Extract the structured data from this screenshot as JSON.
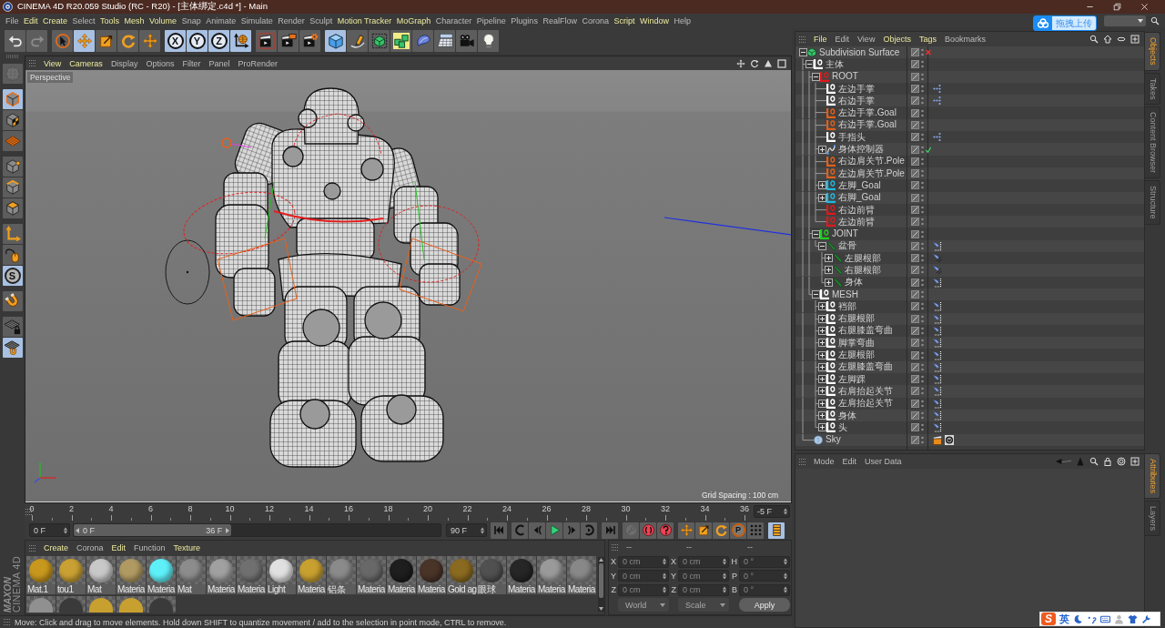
{
  "window": {
    "title": "CINEMA 4D R20.059 Studio (RC - R20) - [主体绑定.c4d *] - Main"
  },
  "menu_bar": [
    {
      "label": "File",
      "highlighted": false
    },
    {
      "label": "Edit",
      "highlighted": true
    },
    {
      "label": "Create",
      "highlighted": true
    },
    {
      "label": "Select",
      "highlighted": false
    },
    {
      "label": "Tools",
      "highlighted": true
    },
    {
      "label": "Mesh",
      "highlighted": true
    },
    {
      "label": "Volume",
      "highlighted": true
    },
    {
      "label": "Snap",
      "highlighted": false
    },
    {
      "label": "Animate",
      "highlighted": false
    },
    {
      "label": "Simulate",
      "highlighted": false
    },
    {
      "label": "Render",
      "highlighted": false
    },
    {
      "label": "Sculpt",
      "highlighted": false
    },
    {
      "label": "Motion Tracker",
      "highlighted": true
    },
    {
      "label": "MoGraph",
      "highlighted": true
    },
    {
      "label": "Character",
      "highlighted": false
    },
    {
      "label": "Pipeline",
      "highlighted": false
    },
    {
      "label": "Plugins",
      "highlighted": false
    },
    {
      "label": "RealFlow",
      "highlighted": false
    },
    {
      "label": "Corona",
      "highlighted": false
    },
    {
      "label": "Script",
      "highlighted": true
    },
    {
      "label": "Window",
      "highlighted": true
    },
    {
      "label": "Help",
      "highlighted": false
    }
  ],
  "upload_widget": {
    "label": "拖拽上传"
  },
  "toolbar": [
    {
      "tools": [
        {
          "kind": "undo",
          "on": false,
          "disabled": false
        },
        {
          "kind": "redo",
          "on": false,
          "disabled": true
        }
      ]
    },
    {
      "tools": [
        {
          "kind": "live-select",
          "on": false,
          "disabled": false
        },
        {
          "kind": "move",
          "on": true,
          "disabled": false
        },
        {
          "kind": "scale",
          "on": false,
          "disabled": false
        },
        {
          "kind": "rotate",
          "on": false,
          "disabled": false
        },
        {
          "kind": "recent-tool",
          "on": false,
          "disabled": false
        }
      ]
    },
    {
      "tools": [
        {
          "kind": "axis-x",
          "label": "X",
          "on": true,
          "disabled": false
        },
        {
          "kind": "axis-y",
          "label": "Y",
          "on": true,
          "disabled": false
        },
        {
          "kind": "axis-z",
          "label": "Z",
          "on": true,
          "disabled": false
        },
        {
          "kind": "coordinate-system",
          "on": true,
          "disabled": false
        }
      ]
    },
    {
      "tools": [
        {
          "kind": "render-view",
          "on": false,
          "disabled": false
        },
        {
          "kind": "render-to-viewer",
          "on": false,
          "disabled": false
        },
        {
          "kind": "render-settings",
          "on": false,
          "disabled": false
        }
      ]
    },
    {
      "tools": [
        {
          "kind": "cube",
          "on": true,
          "disabled": false
        },
        {
          "kind": "pen",
          "on": false,
          "disabled": false
        },
        {
          "kind": "subdivision",
          "on": false,
          "disabled": false
        },
        {
          "kind": "array",
          "on": false,
          "disabled": false
        },
        {
          "kind": "deformer",
          "on": false,
          "disabled": false
        },
        {
          "kind": "floor",
          "on": false,
          "disabled": false
        },
        {
          "kind": "camera",
          "on": false,
          "disabled": false
        },
        {
          "kind": "light",
          "on": false,
          "disabled": false
        }
      ]
    }
  ],
  "tool_palette": [
    {
      "tools": [
        {
          "kind": "make-editable",
          "on": false,
          "disabled": true
        }
      ]
    },
    {
      "tools": [
        {
          "kind": "model-mode",
          "on": true,
          "disabled": false
        },
        {
          "kind": "texture-mode",
          "on": false,
          "disabled": false
        },
        {
          "kind": "workplane-mode",
          "on": false,
          "disabled": false
        }
      ]
    },
    {
      "tools": [
        {
          "kind": "points-mode",
          "on": false,
          "disabled": false
        },
        {
          "kind": "edges-mode",
          "on": false,
          "disabled": false
        },
        {
          "kind": "polygons-mode",
          "on": false,
          "disabled": false
        }
      ]
    },
    {
      "tools": [
        {
          "kind": "axis-mode",
          "on": false,
          "disabled": false
        },
        {
          "kind": "tweak-mode",
          "on": false,
          "disabled": false
        },
        {
          "kind": "solo",
          "label": "S",
          "on": true,
          "disabled": false
        }
      ]
    },
    {
      "tools": [
        {
          "kind": "snap",
          "on": false,
          "disabled": false
        }
      ]
    },
    {
      "tools": [
        {
          "kind": "workplane-lock",
          "on": false,
          "disabled": false
        },
        {
          "kind": "planar-snap",
          "on": true,
          "disabled": false
        }
      ]
    }
  ],
  "viewport": {
    "menu": [
      {
        "label": "View",
        "highlighted": true
      },
      {
        "label": "Cameras",
        "highlighted": true
      },
      {
        "label": "Display",
        "highlighted": false
      },
      {
        "label": "Options",
        "highlighted": false
      },
      {
        "label": "Filter",
        "highlighted": false
      },
      {
        "label": "Panel",
        "highlighted": false
      },
      {
        "label": "ProRender",
        "highlighted": false
      }
    ],
    "camera": "Perspective",
    "grid_spacing": "Grid Spacing : 100 cm"
  },
  "timeline": {
    "ticks": [
      "0",
      "2",
      "4",
      "6",
      "8",
      "10",
      "12",
      "14",
      "16",
      "18",
      "20",
      "22",
      "24",
      "26",
      "28",
      "30",
      "32",
      "34",
      "36"
    ],
    "frame_field": "-5 F"
  },
  "transport": {
    "start_field": "0 F",
    "range": {
      "start": "0 F",
      "end": "36 F",
      "level": 0.43
    },
    "end_field": "90 F",
    "groups": [
      {
        "tools": [
          {
            "kind": "go-start",
            "on": false,
            "disabled": false
          }
        ]
      },
      {
        "tools": [
          {
            "kind": "prev-key",
            "on": false,
            "disabled": false
          },
          {
            "kind": "prev-frame",
            "on": false,
            "disabled": false
          },
          {
            "kind": "play",
            "on": false,
            "disabled": false
          },
          {
            "kind": "next-frame",
            "on": false,
            "disabled": false
          },
          {
            "kind": "next-key",
            "on": false,
            "disabled": false
          }
        ]
      },
      {
        "tools": [
          {
            "kind": "go-end",
            "on": false,
            "disabled": false
          }
        ]
      },
      {
        "tools": [
          {
            "kind": "keyframe",
            "on": false,
            "disabled": true
          },
          {
            "kind": "record",
            "on": false,
            "disabled": false
          },
          {
            "kind": "autokey",
            "on": false,
            "disabled": false
          }
        ]
      },
      {
        "tools": [
          {
            "kind": "key-position",
            "on": false,
            "disabled": false
          },
          {
            "kind": "key-scale",
            "on": false,
            "disabled": false
          },
          {
            "kind": "key-rotation",
            "on": false,
            "disabled": false
          },
          {
            "kind": "key-param",
            "label": "P",
            "on": false,
            "disabled": false
          },
          {
            "kind": "key-pla",
            "on": false,
            "disabled": false
          }
        ]
      },
      {
        "tools": [
          {
            "kind": "timeline",
            "on": true,
            "disabled": false
          }
        ]
      }
    ]
  },
  "materials": {
    "menu": [
      {
        "label": "Create",
        "highlighted": true
      },
      {
        "label": "Corona",
        "highlighted": false
      },
      {
        "label": "Edit",
        "highlighted": true
      },
      {
        "label": "Function",
        "highlighted": false
      },
      {
        "label": "Texture",
        "highlighted": true
      }
    ],
    "items": [
      {
        "label": "Mat.1",
        "color": "#c8971e"
      },
      {
        "label": "tou1",
        "color": "#c9a033"
      },
      {
        "label": "Mat",
        "color": "#c8c8c8"
      },
      {
        "label": "Materia",
        "color": "#b09a62"
      },
      {
        "label": "Materia",
        "color": "#5ef0f8"
      },
      {
        "label": "Mat",
        "color": "#8c8c8c"
      },
      {
        "label": "Materia",
        "color": "#a0a0a0"
      },
      {
        "label": "Materia",
        "color": "#707070"
      },
      {
        "label": "Light",
        "color": "#e0e0e0"
      },
      {
        "label": "Materia",
        "color": "#c8a030"
      },
      {
        "label": "铝条",
        "color": "#8a8a8a"
      },
      {
        "label": "Materia",
        "color": "#686868"
      },
      {
        "label": "Materia",
        "color": "#1e1e1e"
      },
      {
        "label": "Materia",
        "color": "#4a3428"
      },
      {
        "label": "Gold ag",
        "color": "#8a6a20"
      },
      {
        "label": "眼球",
        "color": "#505050"
      },
      {
        "label": "Materia",
        "color": "#262626"
      },
      {
        "label": "Materia",
        "color": "#9a9a9a"
      },
      {
        "label": "Materia",
        "color": "#888888"
      },
      {
        "color": "#909090"
      },
      {
        "color": "#3a3a3a"
      },
      {
        "color": "#c8a030"
      },
      {
        "color": "#c8a030"
      },
      {
        "color": "#3a3a3a"
      }
    ]
  },
  "coordinates": {
    "headers": [
      "--",
      "--",
      "--"
    ],
    "columns": [
      {
        "fields": [
          {
            "label": "X",
            "value": "0 cm",
            "disabled": true
          },
          {
            "label": "Y",
            "value": "0 cm",
            "disabled": true
          },
          {
            "label": "Z",
            "value": "0 cm",
            "disabled": true
          }
        ]
      },
      {
        "fields": [
          {
            "label": "X",
            "value": "0 cm",
            "disabled": true
          },
          {
            "label": "Y",
            "value": "0 cm",
            "disabled": true
          },
          {
            "label": "Z",
            "value": "0 cm",
            "disabled": true
          }
        ]
      },
      {
        "fields": [
          {
            "label": "H",
            "value": "0 °",
            "disabled": true
          },
          {
            "label": "P",
            "value": "0 °",
            "disabled": true
          },
          {
            "label": "B",
            "value": "0 °",
            "disabled": true
          }
        ]
      }
    ],
    "dropdowns": [
      {
        "value": "World",
        "disabled": true
      },
      {
        "value": "Scale",
        "disabled": true
      }
    ],
    "apply": {
      "label": "Apply",
      "disabled": false
    }
  },
  "logo": {
    "brand": "MAXON",
    "product": "CINEMA 4D"
  },
  "status_bar": {
    "text": "Move: Click and drag to move elements. Hold down SHIFT to quantize movement / add to the selection in point mode, CTRL to remove."
  },
  "object_manager": {
    "menu": [
      {
        "label": "File",
        "highlighted": true
      },
      {
        "label": "Edit",
        "highlighted": false
      },
      {
        "label": "View",
        "highlighted": false
      },
      {
        "label": "Objects",
        "highlighted": true
      },
      {
        "label": "Tags",
        "highlighted": true
      },
      {
        "label": "Bookmarks",
        "highlighted": false
      }
    ],
    "tree": [
      {
        "name": "Subdivision Surface",
        "kind": "subdivision",
        "expanded": true,
        "enabled": false,
        "children": [
          {
            "name": "主体",
            "kind": "null",
            "color": "#ffffff",
            "expanded": true,
            "children": [
              {
                "name": "ROOT",
                "kind": "null",
                "color": "#e01818",
                "expanded": true,
                "children": [
                  {
                    "name": "左边手掌",
                    "kind": "null",
                    "color": "#ffffff",
                    "tags": [
                      {
                        "kind": "ik"
                      }
                    ]
                  },
                  {
                    "name": "右边手掌",
                    "kind": "null",
                    "color": "#ffffff",
                    "tags": [
                      {
                        "kind": "ik"
                      }
                    ]
                  },
                  {
                    "name": "左边手掌.Goal",
                    "kind": "null",
                    "color": "#e0601a"
                  },
                  {
                    "name": "右边手掌.Goal",
                    "kind": "null",
                    "color": "#e0601a"
                  },
                  {
                    "name": "手指头",
                    "kind": "null",
                    "color": "#ffffff",
                    "tags": [
                      {
                        "kind": "ik"
                      }
                    ]
                  },
                  {
                    "name": "身体控制器",
                    "kind": "spline",
                    "expanded": false,
                    "enabled": true
                  },
                  {
                    "name": "右边肩关节.Pole",
                    "kind": "null",
                    "color": "#e0601a"
                  },
                  {
                    "name": "左边肩关节.Pole",
                    "kind": "null",
                    "color": "#e0601a"
                  },
                  {
                    "name": "左脚_Goal",
                    "kind": "null",
                    "color": "#20b8e0",
                    "expanded": false
                  },
                  {
                    "name": "右脚_Goal",
                    "kind": "null",
                    "color": "#20b8e0",
                    "expanded": false
                  },
                  {
                    "name": "右边前臂",
                    "kind": "null",
                    "color": "#e01818"
                  },
                  {
                    "name": "左边前臂",
                    "kind": "null",
                    "color": "#e01818"
                  }
                ]
              },
              {
                "name": "JOINT",
                "kind": "null",
                "color": "#20d020",
                "expanded": true,
                "children": [
                  {
                    "name": "盆骨",
                    "kind": "joint",
                    "expanded": true,
                    "tags": [
                      {
                        "kind": "weight"
                      }
                    ],
                    "children": [
                      {
                        "name": "左腿根部",
                        "kind": "joint",
                        "expanded": false,
                        "tags": [
                          {
                            "kind": "weight-alt"
                          }
                        ]
                      },
                      {
                        "name": "右腿根部",
                        "kind": "joint",
                        "expanded": false,
                        "tags": [
                          {
                            "kind": "weight-alt"
                          }
                        ]
                      },
                      {
                        "name": "身体",
                        "kind": "joint",
                        "expanded": false,
                        "tags": [
                          {
                            "kind": "weight"
                          }
                        ]
                      }
                    ]
                  }
                ]
              },
              {
                "name": "MESH",
                "kind": "null",
                "color": "#ffffff",
                "expanded": true,
                "children": [
                  {
                    "name": "裆部",
                    "kind": "null",
                    "color": "#ffffff",
                    "expanded": false,
                    "tags": [
                      {
                        "kind": "weight"
                      }
                    ]
                  },
                  {
                    "name": "右腿根部",
                    "kind": "null",
                    "color": "#ffffff",
                    "expanded": false,
                    "tags": [
                      {
                        "kind": "weight"
                      }
                    ]
                  },
                  {
                    "name": "右腿膝盖弯曲",
                    "kind": "null",
                    "color": "#ffffff",
                    "expanded": false,
                    "tags": [
                      {
                        "kind": "weight"
                      }
                    ]
                  },
                  {
                    "name": "脚掌弯曲",
                    "kind": "null",
                    "color": "#ffffff",
                    "expanded": false,
                    "tags": [
                      {
                        "kind": "weight"
                      }
                    ]
                  },
                  {
                    "name": "左腿根部",
                    "kind": "null",
                    "color": "#ffffff",
                    "expanded": false,
                    "tags": [
                      {
                        "kind": "weight"
                      }
                    ]
                  },
                  {
                    "name": "左腿膝盖弯曲",
                    "kind": "null",
                    "color": "#ffffff",
                    "expanded": false,
                    "tags": [
                      {
                        "kind": "weight"
                      }
                    ]
                  },
                  {
                    "name": "左脚踝",
                    "kind": "null",
                    "color": "#ffffff",
                    "expanded": false,
                    "tags": [
                      {
                        "kind": "weight"
                      }
                    ]
                  },
                  {
                    "name": "右肩抬起关节",
                    "kind": "null",
                    "color": "#ffffff",
                    "expanded": false,
                    "tags": [
                      {
                        "kind": "weight"
                      }
                    ]
                  },
                  {
                    "name": "左肩抬起关节",
                    "kind": "null",
                    "color": "#ffffff",
                    "expanded": false,
                    "tags": [
                      {
                        "kind": "weight"
                      }
                    ]
                  },
                  {
                    "name": "身体",
                    "kind": "null",
                    "color": "#ffffff",
                    "expanded": false,
                    "tags": [
                      {
                        "kind": "weight"
                      }
                    ]
                  },
                  {
                    "name": "头",
                    "kind": "null",
                    "color": "#ffffff",
                    "expanded": false,
                    "tags": [
                      {
                        "kind": "weight"
                      }
                    ]
                  }
                ]
              }
            ]
          },
          {
            "name": "Sky",
            "kind": "sky",
            "tags": [
              {
                "kind": "clapper"
              },
              {
                "kind": "dial"
              }
            ]
          }
        ]
      }
    ]
  },
  "attribute_manager": {
    "menu": [
      {
        "label": "Mode",
        "highlighted": false
      },
      {
        "label": "Edit",
        "highlighted": false
      },
      {
        "label": "User Data",
        "highlighted": false
      }
    ]
  },
  "side_tabs": {
    "upper": [
      {
        "label": "Objects",
        "selected": true
      },
      {
        "label": "Takes",
        "selected": false
      },
      {
        "label": "Content Browser",
        "selected": false
      },
      {
        "label": "Structure",
        "selected": false
      }
    ],
    "lower": [
      {
        "label": "Attributes",
        "selected": true
      },
      {
        "label": "Layers",
        "selected": false
      }
    ]
  },
  "ime_bar": {
    "logo": "S",
    "mode": "英"
  }
}
